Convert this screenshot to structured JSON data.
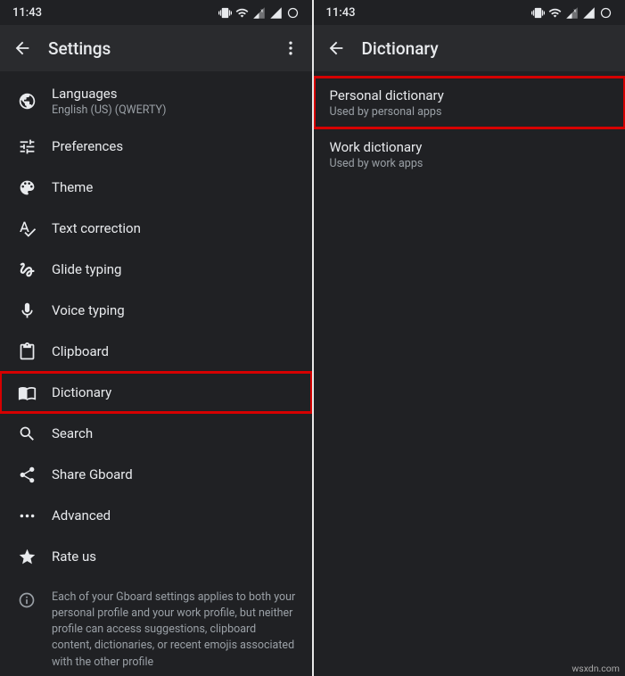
{
  "statusbar": {
    "time": "11:43"
  },
  "left": {
    "title": "Settings",
    "items": [
      {
        "label": "Languages",
        "sub": "English (US) (QWERTY)"
      },
      {
        "label": "Preferences"
      },
      {
        "label": "Theme"
      },
      {
        "label": "Text correction"
      },
      {
        "label": "Glide typing"
      },
      {
        "label": "Voice typing"
      },
      {
        "label": "Clipboard"
      },
      {
        "label": "Dictionary"
      },
      {
        "label": "Search"
      },
      {
        "label": "Share Gboard"
      },
      {
        "label": "Advanced"
      },
      {
        "label": "Rate us"
      }
    ],
    "footer": "Each of your Gboard settings applies to both your personal profile and your work profile, but neither profile can access suggestions, clipboard content, dictionaries, or recent emojis associated with the other profile"
  },
  "right": {
    "title": "Dictionary",
    "items": [
      {
        "label": "Personal dictionary",
        "sub": "Used by personal apps"
      },
      {
        "label": "Work dictionary",
        "sub": "Used by work apps"
      }
    ]
  },
  "watermark": "wsxdn.com"
}
